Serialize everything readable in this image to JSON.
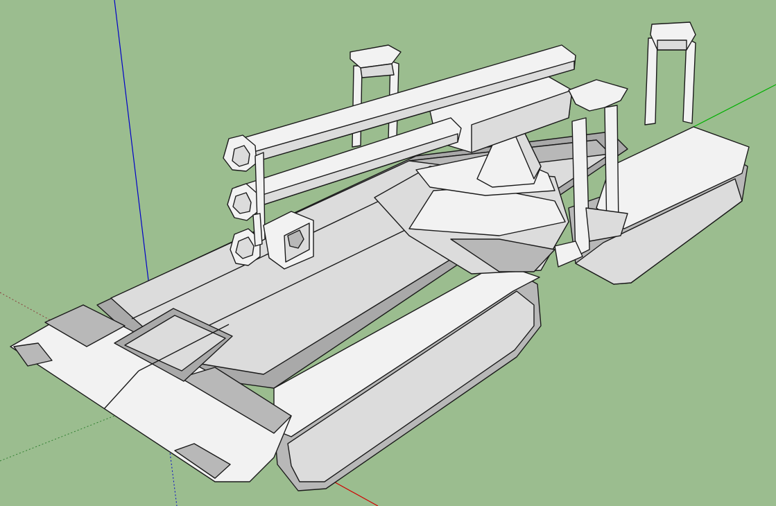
{
  "app": {
    "viewport": "sketchup-3d-viewport",
    "background_color": "#9bbd8f",
    "face_color": "#efefef",
    "shade_color": "#bdbdbd",
    "edge_color": "#1a1a1a"
  },
  "axes": {
    "red": "#d10000",
    "green": "#00b000",
    "blue": "#0000c8"
  },
  "model": {
    "subject": "tracked-vehicle-model",
    "parts": [
      "left-track",
      "right-track",
      "hull",
      "front-plate",
      "turret-base",
      "turret-cone",
      "twin-tubes",
      "tube-cluster",
      "tube-bracket",
      "support-frame-left",
      "support-frame-middle",
      "support-frame-right"
    ]
  }
}
